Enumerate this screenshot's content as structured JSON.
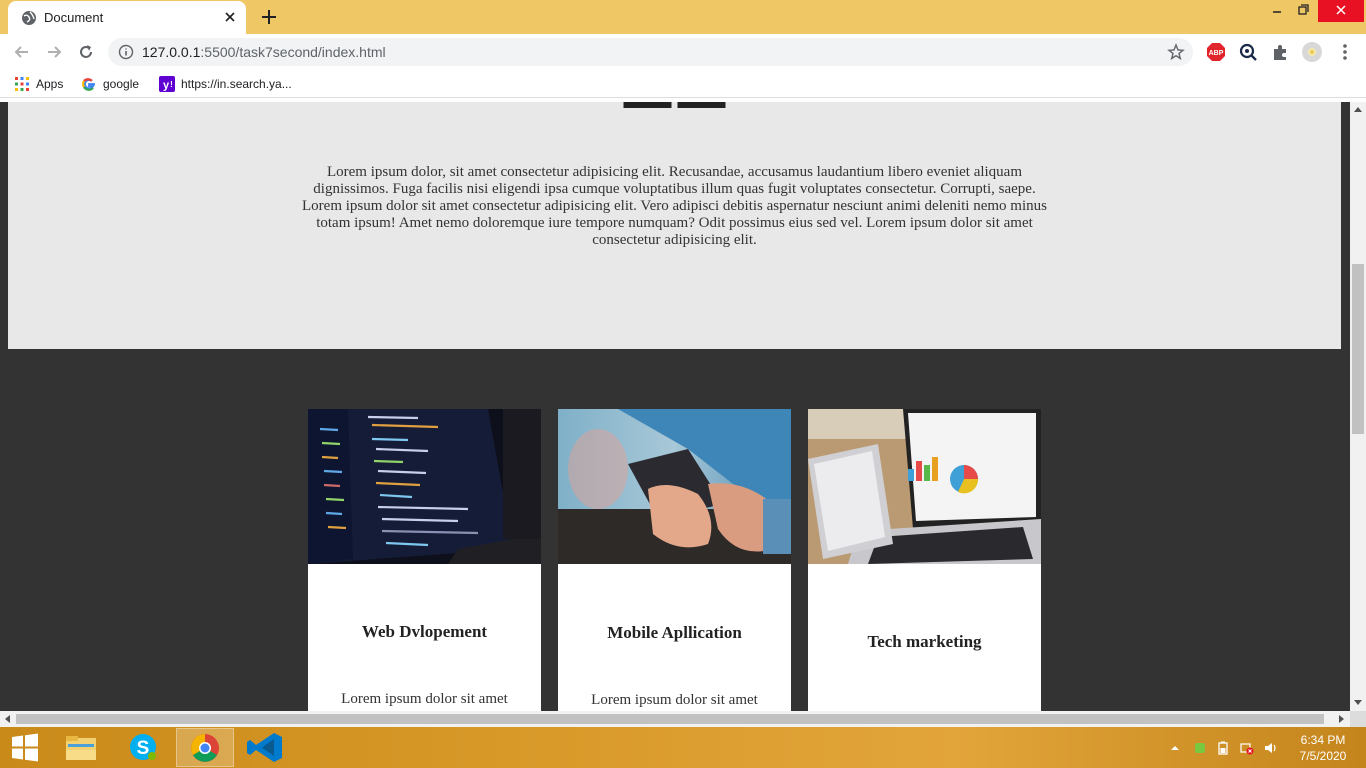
{
  "browser": {
    "tab_title": "Document",
    "url_host": "127.0.0.1",
    "url_rest": ":5500/task7second/index.html"
  },
  "bookmarks": [
    {
      "label": "Apps",
      "icon": "apps-grid-icon"
    },
    {
      "label": "google",
      "icon": "google-icon"
    },
    {
      "label": "https://in.search.ya...",
      "icon": "yahoo-icon"
    }
  ],
  "page": {
    "intro_text": "Lorem ipsum dolor, sit amet consectetur adipisicing elit. Recusandae, accusamus laudantium libero eveniet aliquam dignissimos. Fuga facilis nisi eligendi ipsa cumque voluptatibus illum quas fugit voluptates consectetur. Corrupti, saepe. Lorem ipsum dolor sit amet consectetur adipisicing elit. Vero adipisci debitis aspernatur nesciunt animi deleniti nemo minus totam ipsum! Amet nemo doloremque iure tempore numquam? Odit possimus eius sed vel. Lorem ipsum dolor sit amet consectetur adipisicing elit.",
    "cards": [
      {
        "title": "Web Dvlopement",
        "text": "Lorem ipsum dolor sit amet"
      },
      {
        "title": "Mobile Apllication",
        "text": "Lorem ipsum dolor sit amet"
      },
      {
        "title": "Tech marketing",
        "text": ""
      }
    ]
  },
  "taskbar": {
    "time": "6:34 PM",
    "date": "7/5/2020"
  },
  "colors": {
    "tabstrip": "#f0c765",
    "page_dark": "#333333",
    "page_gray": "#e8e8e8"
  }
}
